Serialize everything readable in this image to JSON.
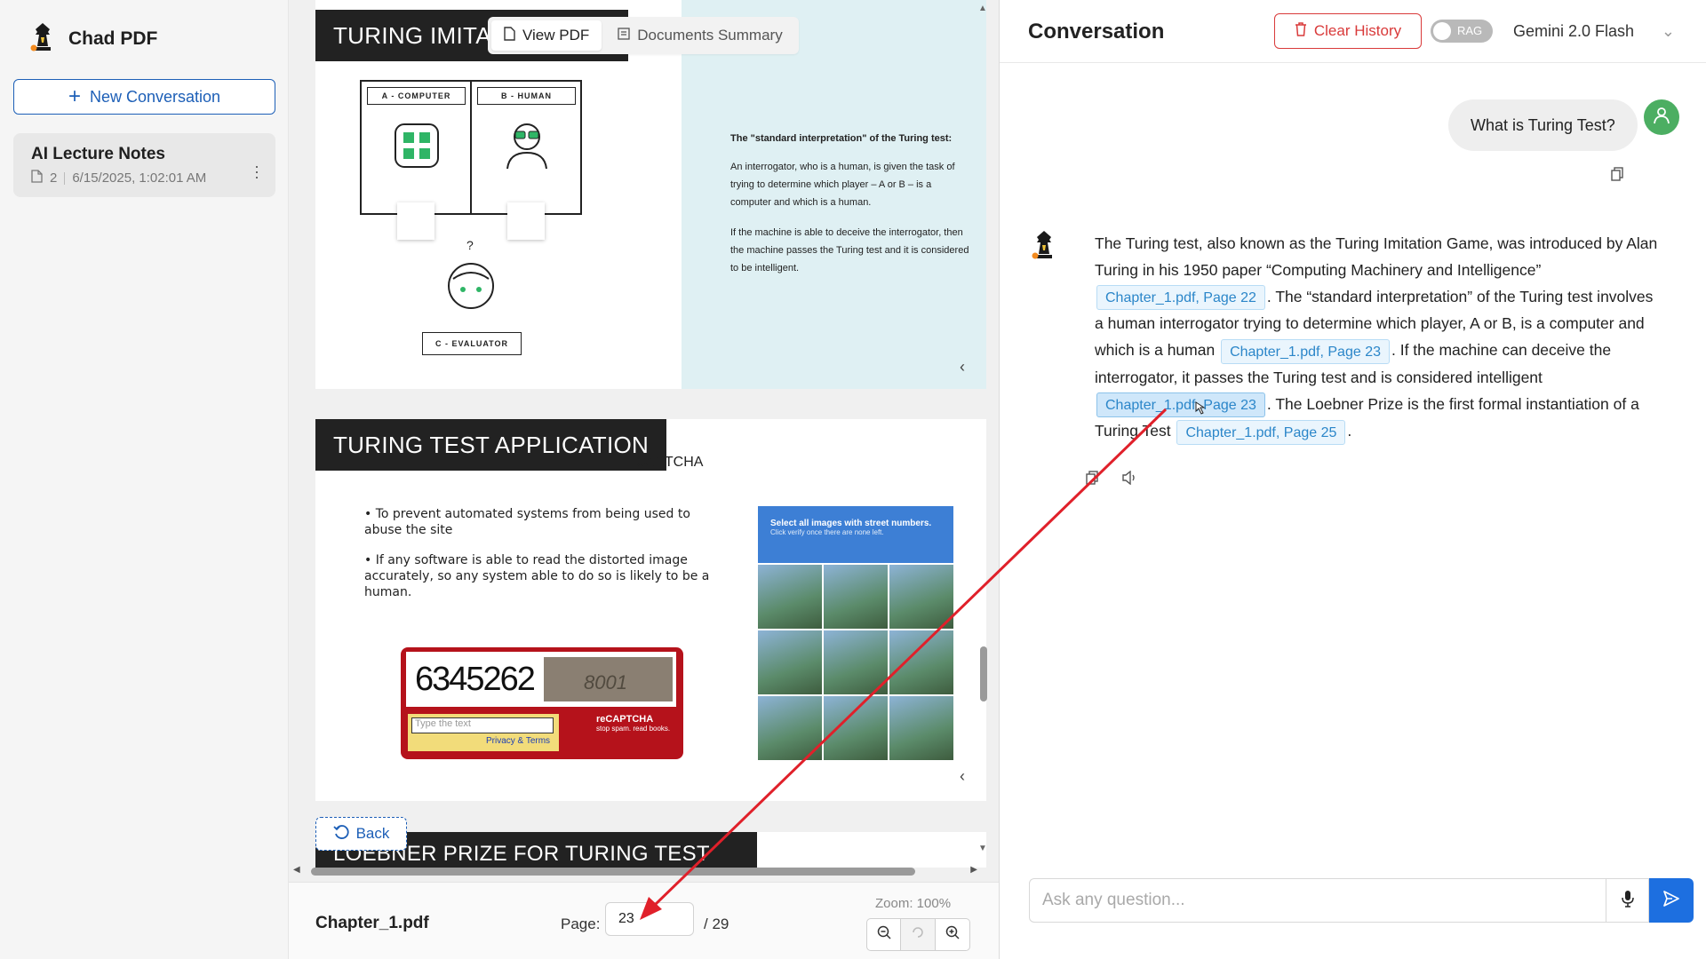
{
  "app": {
    "name": "Chad PDF"
  },
  "sidebar": {
    "new_conversation_label": "New Conversation",
    "conversations": [
      {
        "title": "AI Lecture Notes",
        "doc_count": "2",
        "timestamp": "6/15/2025, 1:02:01 AM"
      }
    ]
  },
  "viewer": {
    "tabs": [
      {
        "label": "View PDF",
        "active": true,
        "icon": "file-pdf-icon"
      },
      {
        "label": "Documents Summary",
        "active": false,
        "icon": "summary-icon"
      }
    ],
    "slides": [
      {
        "heading": "TURING IMITAT",
        "labels": {
          "a": "A - COMPUTER",
          "b": "B - HUMAN",
          "c": "C - EVALUATOR",
          "question": "?"
        },
        "panel_title": "The \"standard interpretation\" of the Turing test:",
        "panel_p1": "An interrogator, who is a human, is given the task of trying to determine which player – A or B – is a computer and which is a human.",
        "panel_p2": "If the machine is able to deceive the interrogator, then the machine passes the Turing test and it is considered to be intelligent."
      },
      {
        "heading": "TURING TEST APPLICATION",
        "subheading": "CAPTCHA",
        "bullets": [
          "• To prevent automated systems from being used to abuse the site",
          "• If any software is able to read the distorted image accurately, so any system able to do so is likely to be a human."
        ],
        "captcha_number": "6345262",
        "captcha_word": "8001",
        "captcha_placeholder": "Type the text",
        "captcha_links": "Privacy & Terms",
        "captcha_brand": "reCAPTCHA",
        "captcha_tagline": "stop spam. read books.",
        "grid_title": "Select all images with street numbers.",
        "grid_subtitle": "Click verify once there are none left."
      },
      {
        "heading": "LOEBNER PRIZE FOR TURING TEST"
      }
    ],
    "back_label": "Back",
    "footer": {
      "file_name": "Chapter_1.pdf",
      "page_label": "Page:",
      "page_value": "23",
      "page_total": "/ 29",
      "zoom_label": "Zoom: 100%"
    }
  },
  "chat": {
    "title": "Conversation",
    "clear_label": "Clear History",
    "rag_label": "RAG",
    "rag_on": false,
    "model": "Gemini 2.0 Flash",
    "user_message": "What is Turing Test?",
    "bot_message": {
      "parts": [
        {
          "type": "text",
          "value": "The Turing test, also known as the Turing Imitation Game, was introduced by Alan Turing in his 1950 paper “Computing Machinery and Intelligence” "
        },
        {
          "type": "cite",
          "value": "Chapter_1.pdf, Page 22"
        },
        {
          "type": "text",
          "value": ". The “standard interpretation” of the Turing test involves a human interrogator trying to determine which player, A or B, is a computer and which is a human "
        },
        {
          "type": "cite",
          "value": "Chapter_1.pdf, Page 23"
        },
        {
          "type": "text",
          "value": ". If the machine can deceive the interrogator, it passes the Turing test and is considered intelligent "
        },
        {
          "type": "cite",
          "value": "Chapter_1.pdf, Page 23",
          "hover": true
        },
        {
          "type": "text",
          "value": ". The Loebner Prize is the first formal instantiation of a Turing Test "
        },
        {
          "type": "cite",
          "value": "Chapter_1.pdf, Page 25"
        },
        {
          "type": "text",
          "value": "."
        }
      ]
    },
    "input_placeholder": "Ask any question..."
  },
  "colors": {
    "primary": "#1d5fb7",
    "danger": "#d93a3a",
    "send": "#1d6fe0",
    "cite_bg": "#eaf5fd",
    "cite_text": "#2b86c9",
    "annotation": "#e0202a",
    "user_avatar": "#4cae62"
  }
}
